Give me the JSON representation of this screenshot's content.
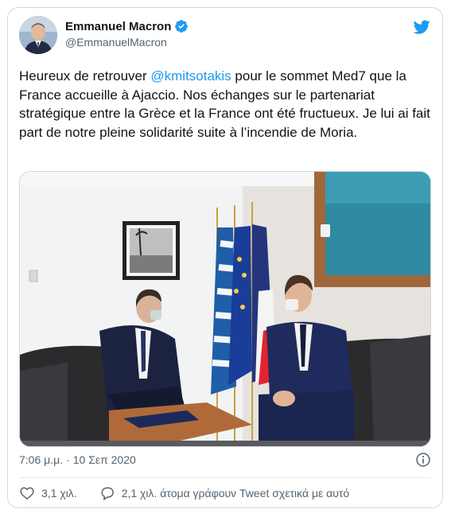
{
  "author": {
    "name": "Emmanuel Macron",
    "handle": "@EmmanuelMacron"
  },
  "tweet": {
    "text_before": "Heureux de retrouver ",
    "mention": "@kmitsotakis",
    "text_after": " pour le sommet Med7 que la France accueille à Ajaccio. Nos échanges sur le partenariat stratégique entre la Grèce et la France ont été fructueux. Je lui ai fait part de notre pleine solidarité suite à l’incendie de Moria."
  },
  "meta": {
    "time": "7:06 μ.μ.",
    "separator": "·",
    "date": "10 Σεπ 2020"
  },
  "actions": {
    "likes": "3,1 χιλ.",
    "replies": "2,1 χιλ. άτομα γράφουν Tweet σχετικά με αυτό"
  },
  "icons": {
    "verified": "verified-badge-icon",
    "brand": "twitter-bird-icon",
    "info": "info-icon",
    "like": "heart-icon",
    "reply": "comment-bubble-icon"
  },
  "colors": {
    "accent": "#1d9bf0",
    "text": "#0f1419",
    "secondary": "#536471"
  }
}
